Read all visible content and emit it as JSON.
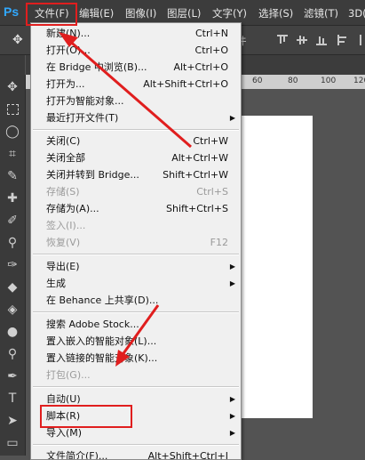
{
  "app": {
    "logo": "Ps"
  },
  "menubar": {
    "items": [
      {
        "label": "文件(F)"
      },
      {
        "label": "编辑(E)"
      },
      {
        "label": "图像(I)"
      },
      {
        "label": "图层(L)"
      },
      {
        "label": "文字(Y)"
      },
      {
        "label": "选择(S)"
      },
      {
        "label": "滤镜(T)"
      },
      {
        "label": "3D("
      }
    ]
  },
  "options_bar": {
    "partial_text": "件"
  },
  "ruler": {
    "numbers": [
      "60",
      "80",
      "100",
      "120"
    ]
  },
  "file_menu": {
    "items": [
      {
        "label": "新建(N)...",
        "shortcut": "Ctrl+N",
        "disabled": false
      },
      {
        "label": "打开(O)...",
        "shortcut": "Ctrl+O",
        "disabled": false
      },
      {
        "label": "在 Bridge 中浏览(B)...",
        "shortcut": "Alt+Ctrl+O",
        "disabled": false
      },
      {
        "label": "打开为...",
        "shortcut": "Alt+Shift+Ctrl+O",
        "disabled": false
      },
      {
        "label": "打开为智能对象...",
        "shortcut": "",
        "disabled": false
      },
      {
        "label": "最近打开文件(T)",
        "shortcut": "",
        "submenu": true,
        "disabled": false
      },
      {
        "label": "关闭(C)",
        "shortcut": "Ctrl+W",
        "disabled": false
      },
      {
        "label": "关闭全部",
        "shortcut": "Alt+Ctrl+W",
        "disabled": false
      },
      {
        "label": "关闭并转到 Bridge...",
        "shortcut": "Shift+Ctrl+W",
        "disabled": false
      },
      {
        "label": "存储(S)",
        "shortcut": "Ctrl+S",
        "disabled": true
      },
      {
        "label": "存储为(A)...",
        "shortcut": "Shift+Ctrl+S",
        "disabled": false
      },
      {
        "label": "签入(I)...",
        "shortcut": "",
        "disabled": true
      },
      {
        "label": "恢复(V)",
        "shortcut": "F12",
        "disabled": true
      },
      {
        "label": "导出(E)",
        "shortcut": "",
        "submenu": true,
        "disabled": false
      },
      {
        "label": "生成",
        "shortcut": "",
        "submenu": true,
        "disabled": false
      },
      {
        "label": "在 Behance 上共享(D)...",
        "shortcut": "",
        "disabled": false
      },
      {
        "label": "搜索 Adobe Stock...",
        "shortcut": "",
        "disabled": false
      },
      {
        "label": "置入嵌入的智能对象(L)...",
        "shortcut": "",
        "disabled": false
      },
      {
        "label": "置入链接的智能对象(K)...",
        "shortcut": "",
        "disabled": false
      },
      {
        "label": "打包(G)...",
        "shortcut": "",
        "disabled": true
      },
      {
        "label": "自动(U)",
        "shortcut": "",
        "submenu": true,
        "disabled": false
      },
      {
        "label": "脚本(R)",
        "shortcut": "",
        "submenu": true,
        "disabled": false
      },
      {
        "label": "导入(M)",
        "shortcut": "",
        "submenu": true,
        "disabled": false
      },
      {
        "label": "文件简介(F)...",
        "shortcut": "Alt+Shift+Ctrl+I",
        "disabled": false
      }
    ]
  },
  "colors": {
    "annotation_red": "#e01e1e",
    "menu_bg": "#f0f0f0",
    "chrome_dark": "#3c3c3c"
  }
}
